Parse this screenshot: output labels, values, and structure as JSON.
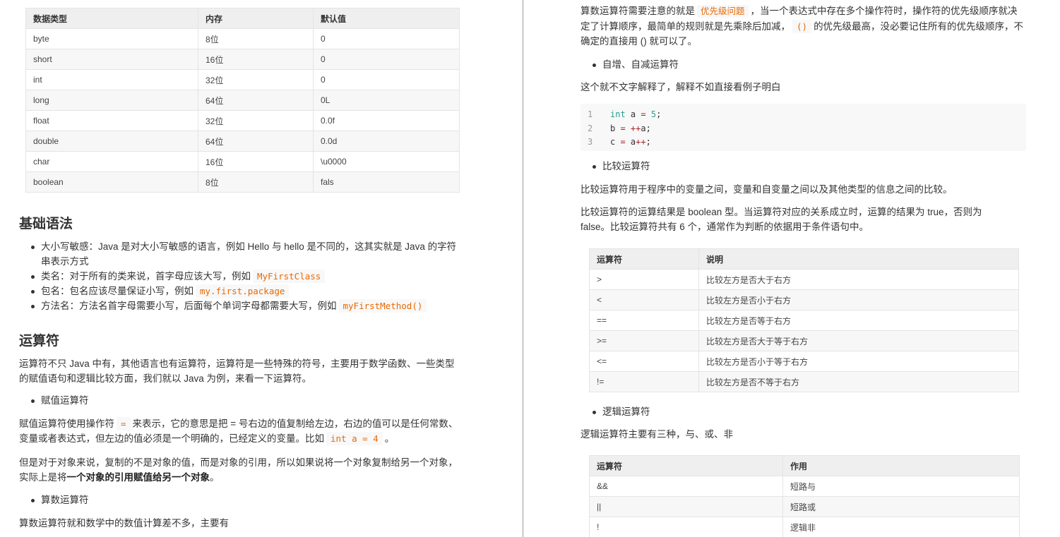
{
  "left": {
    "types_table": {
      "headers": [
        "数据类型",
        "内存",
        "默认值"
      ],
      "rows": [
        [
          "byte",
          "8位",
          "0"
        ],
        [
          "short",
          "16位",
          "0"
        ],
        [
          "int",
          "32位",
          "0"
        ],
        [
          "long",
          "64位",
          "0L"
        ],
        [
          "float",
          "32位",
          "0.0f"
        ],
        [
          "double",
          "64位",
          "0.0d"
        ],
        [
          "char",
          "16位",
          "\\u0000"
        ],
        [
          "boolean",
          "8位",
          "fals"
        ]
      ]
    },
    "basic_syntax": {
      "heading": "基础语法",
      "items": [
        {
          "text": "大小写敏感：Java 是对大小写敏感的语言，例如 Hello 与 hello 是不同的，这其实就是 Java 的字符串表示方式",
          "code": ""
        },
        {
          "text": "类名：对于所有的类来说，首字母应该大写，例如",
          "code": "MyFirstClass"
        },
        {
          "text": "包名：包名应该尽量保证小写，例如",
          "code": "my.first.package"
        },
        {
          "text": "方法名：方法名首字母需要小写，后面每个单词字母都需要大写，例如",
          "code": "myFirstMethod()"
        }
      ]
    },
    "operators": {
      "heading": "运算符",
      "intro": "运算符不只 Java 中有，其他语言也有运算符，运算符是一些特殊的符号，主要用于数学函数、一些类型的赋值语句和逻辑比较方面，我们就以 Java 为例，来看一下运算符。",
      "assign_bullet": "赋值运算符",
      "assign_p1_a": "赋值运算符使用操作符",
      "assign_p1_code1": "=",
      "assign_p1_b": "来表示，它的意思是把 = 号右边的值复制给左边，右边的值可以是任何常数、变量或者表达式，但左边的值必须是一个明确的，已经定义的变量。比如",
      "assign_p1_code2": "int a = 4",
      "assign_p1_c": "。",
      "assign_p2_a": "但是对于对象来说，复制的不是对象的值，而是对象的引用，所以如果说将一个对象复制给另一个对象，实际上是将",
      "assign_p2_strong": "一个对象的引用赋值给另一个对象",
      "assign_p2_c": "。",
      "arith_bullet": "算数运算符",
      "arith_p": "算数运算符就和数学中的数值计算差不多，主要有"
    }
  },
  "right": {
    "arith_note_a": "算数运算符需要注意的就是",
    "arith_note_code1": "优先级问题",
    "arith_note_b": "，当一个表达式中存在多个操作符时，操作符的优先级顺序就决定了计算顺序，最简单的规则就是先乘除后加减，",
    "arith_note_code2": "()",
    "arith_note_c": "的优先级最高，没必要记住所有的优先级顺序，不确定的直接用 () 就可以了。",
    "incdec_bullet": "自增、自减运算符",
    "incdec_p": "这个就不文字解释了，解释不如直接看例子明白",
    "code_lines": [
      {
        "num": "1",
        "tokens": [
          [
            "kw",
            "int"
          ],
          [
            "var",
            " a "
          ],
          [
            "op",
            "="
          ],
          [
            "num",
            " 5"
          ],
          [
            "var",
            ";"
          ]
        ]
      },
      {
        "num": "2",
        "tokens": [
          [
            "var",
            "b "
          ],
          [
            "op",
            "="
          ],
          [
            "op",
            " ++"
          ],
          [
            "var",
            "a;"
          ]
        ]
      },
      {
        "num": "3",
        "tokens": [
          [
            "var",
            "c "
          ],
          [
            "op",
            "="
          ],
          [
            "var",
            " a"
          ],
          [
            "op",
            "++"
          ],
          [
            "var",
            ";"
          ]
        ]
      }
    ],
    "compare_bullet": "比较运算符",
    "compare_p1": "比较运算符用于程序中的变量之间，变量和自变量之间以及其他类型的信息之间的比较。",
    "compare_p2": "比较运算符的运算结果是 boolean 型。当运算符对应的关系成立时，运算的结果为 true，否则为 false。比较运算符共有 6 个，通常作为判断的依据用于条件语句中。",
    "compare_table": {
      "headers": [
        "运算符",
        "说明"
      ],
      "rows": [
        [
          ">",
          "比较左方是否大于右方"
        ],
        [
          "<",
          "比较左方是否小于右方"
        ],
        [
          "==",
          "比较左方是否等于右方"
        ],
        [
          ">=",
          "比较左方是否大于等于右方"
        ],
        [
          "<=",
          "比较左方是否小于等于右方"
        ],
        [
          "!=",
          "比较左方是否不等于右方"
        ]
      ]
    },
    "logic_bullet": "逻辑运算符",
    "logic_p": "逻辑运算符主要有三种，与、或、非",
    "logic_table": {
      "headers": [
        "运算符",
        "作用"
      ],
      "rows": [
        [
          "&&",
          "短路与"
        ],
        [
          "||",
          "短路或"
        ],
        [
          "!",
          "逻辑非"
        ]
      ]
    }
  }
}
